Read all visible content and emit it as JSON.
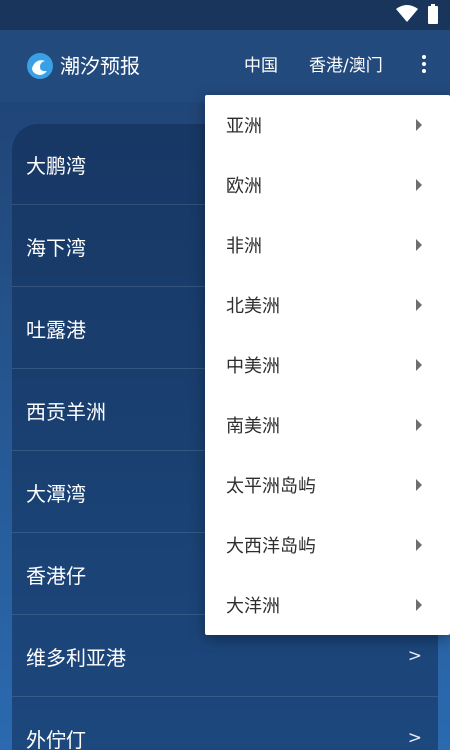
{
  "status_bar": {
    "icons": [
      "wifi-icon",
      "battery-icon"
    ]
  },
  "app_bar": {
    "title": "潮汐预报",
    "tabs": [
      {
        "label": "中国"
      },
      {
        "label": "香港/澳门"
      }
    ],
    "overflow_icon": "more-vert-icon"
  },
  "list": {
    "items": [
      {
        "label": "大鹏湾"
      },
      {
        "label": "海下湾"
      },
      {
        "label": "吐露港"
      },
      {
        "label": "西贡羊洲"
      },
      {
        "label": "大潭湾"
      },
      {
        "label": "香港仔"
      },
      {
        "label": "维多利亚港",
        "chevron": ">"
      },
      {
        "label": "外佇仃",
        "chevron": ">"
      }
    ]
  },
  "menu": {
    "items": [
      {
        "label": "亚洲"
      },
      {
        "label": "欧洲"
      },
      {
        "label": "非洲"
      },
      {
        "label": "北美洲"
      },
      {
        "label": "中美洲"
      },
      {
        "label": "南美洲"
      },
      {
        "label": "太平洲岛屿"
      },
      {
        "label": "大西洋岛屿"
      },
      {
        "label": "大洋洲"
      }
    ]
  },
  "colors": {
    "app_bar": "#234a7d",
    "background": "#24538c",
    "menu_bg": "#ffffff"
  }
}
